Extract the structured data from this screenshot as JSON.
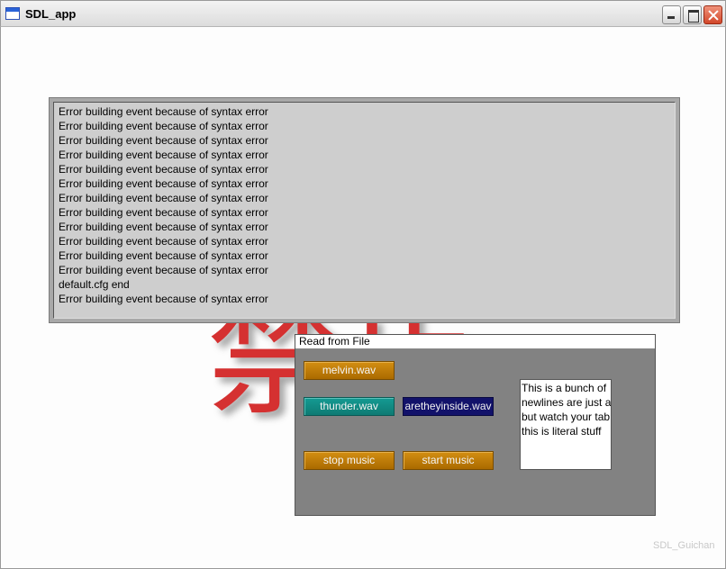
{
  "window": {
    "title": "SDL_app",
    "controls": [
      "minimize-icon",
      "maximize-icon",
      "close-icon"
    ]
  },
  "background_kanji": {
    "upper": "駐車",
    "lower": "禁止"
  },
  "log": {
    "lines": [
      "Error building event because of syntax error",
      "Error building event because of syntax error",
      "Error building event because of syntax error",
      "Error building event because of syntax error",
      "Error building event because of syntax error",
      "Error building event because of syntax error",
      "Error building event because of syntax error",
      "Error building event because of syntax error",
      "Error building event because of syntax error",
      "Error building event because of syntax error",
      "Error building event because of syntax error",
      "Error building event because of syntax error",
      "default.cfg end",
      "Error building event because of syntax error"
    ]
  },
  "dialog": {
    "title": "Read from File",
    "buttons": {
      "melvin": "melvin.wav",
      "thunder": "thunder.wav",
      "aretheyinside": "aretheyinside.wav",
      "stop": "stop music",
      "start": "start music"
    },
    "textarea": {
      "lines": [
        "This is a bunch of",
        "newlines are just a",
        "but watch your tab",
        "this is literal stuff"
      ]
    }
  },
  "watermark": "SDL_Guichan",
  "colors": {
    "button_orange": "#c07f0a",
    "button_teal": "#13908a",
    "button_navy": "#12126a",
    "dialog_bg": "#828282",
    "kanji_red": "#d53131"
  }
}
